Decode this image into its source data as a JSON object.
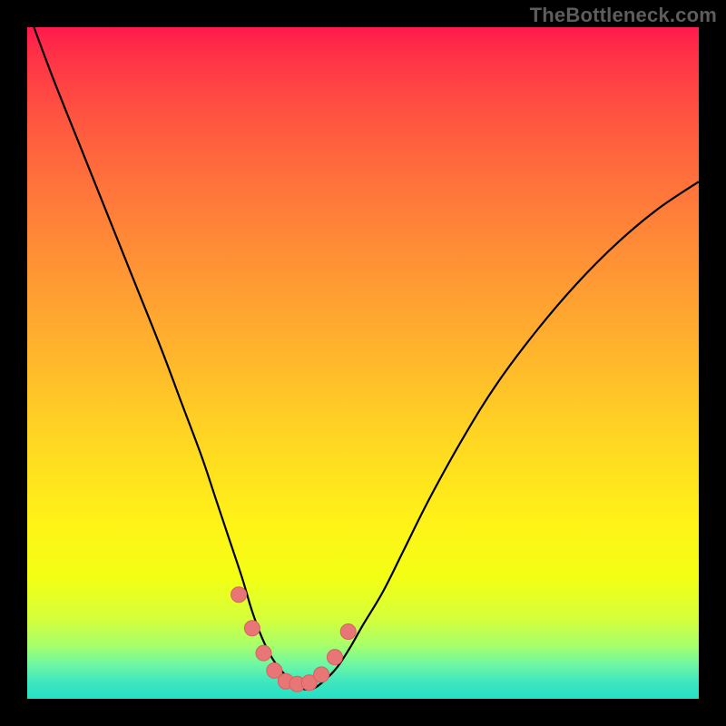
{
  "watermark": "TheBottleneck.com",
  "colors": {
    "page_bg": "#000000",
    "curve_stroke": "#000000",
    "marker_fill": "#e97676",
    "marker_stroke": "#d85f5f"
  },
  "chart_data": {
    "type": "line",
    "title": "",
    "xlabel": "",
    "ylabel": "",
    "xlim": [
      0,
      100
    ],
    "ylim": [
      0,
      100
    ],
    "grid": false,
    "legend": false,
    "note": "Axes are unlabeled (no ticks in source). x,y in percent of plot area; y=0 at bottom (green), y=100 at top (red).",
    "series": [
      {
        "name": "bottleneck-curve",
        "x": [
          1,
          4,
          8,
          12,
          16,
          20,
          23,
          26,
          28,
          30,
          32,
          33.5,
          35,
          36.5,
          38,
          39.5,
          41,
          42.5,
          44,
          46,
          48,
          50,
          53,
          56,
          60,
          65,
          70,
          76,
          82,
          88,
          94,
          100
        ],
        "y": [
          100,
          92,
          82,
          72,
          62,
          52,
          44,
          36,
          30,
          24,
          18,
          13,
          9,
          6,
          4,
          2.5,
          1.5,
          1.5,
          2.5,
          4.5,
          7.5,
          11,
          16,
          22,
          30,
          39,
          47,
          55,
          62,
          68,
          73,
          77
        ]
      }
    ],
    "markers": {
      "name": "valley-points",
      "x": [
        31.5,
        33.5,
        35.2,
        36.8,
        38.5,
        40.2,
        42.0,
        43.8,
        45.8,
        47.8
      ],
      "y": [
        15.5,
        10.5,
        6.8,
        4.2,
        2.6,
        2.2,
        2.4,
        3.6,
        6.2,
        10.0
      ]
    }
  }
}
